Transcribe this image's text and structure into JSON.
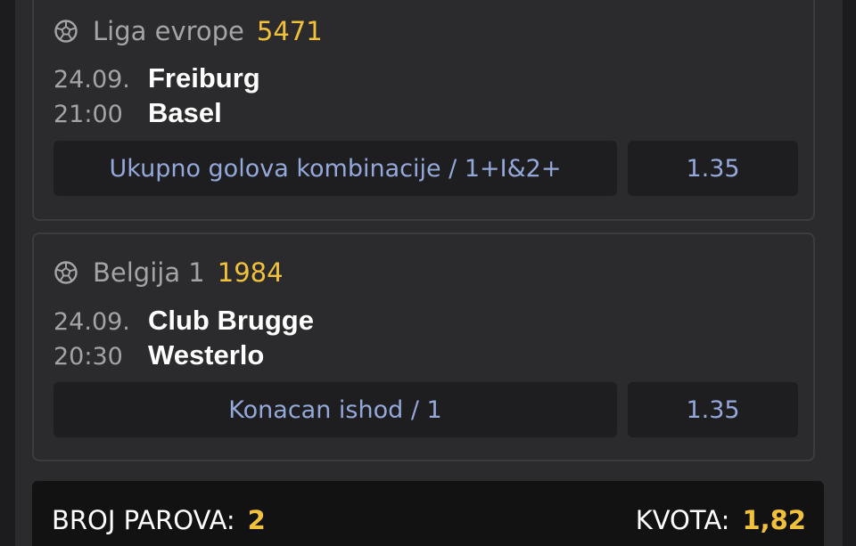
{
  "tickets": [
    {
      "league": "Liga evrope",
      "code": "5471",
      "date": "24.09.",
      "time": "21:00",
      "home": "Freiburg",
      "away": "Basel",
      "bet": "Ukupno golova kombinacije / 1+I&2+",
      "odd": "1.35"
    },
    {
      "league": "Belgija 1",
      "code": "1984",
      "date": "24.09.",
      "time": "20:30",
      "home": "Club Brugge",
      "away": "Westerlo",
      "bet": "Konacan ishod / 1",
      "odd": "1.35"
    }
  ],
  "summary": {
    "pairs_label": "BROJ PAROVA:",
    "pairs_value": "2",
    "odds_label": "KVOTA:",
    "odds_value": "1,82"
  },
  "icons": {
    "sport": "football-icon"
  },
  "colors": {
    "accent": "#f2c13c",
    "bet_text": "#94a8d9",
    "background": "#1c1c1e",
    "card": "#2b2b2d"
  }
}
